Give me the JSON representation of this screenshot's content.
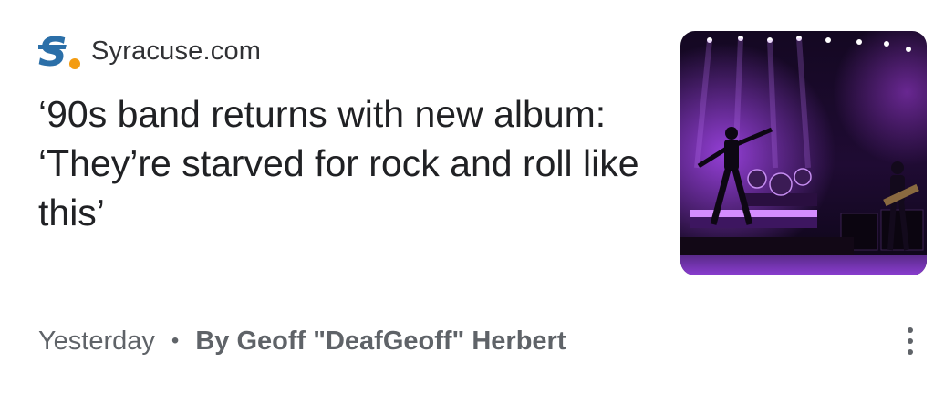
{
  "publisher": {
    "logo_icon": "syracuse-s-logo",
    "name": "Syracuse.com",
    "logo_colors": {
      "letter": "#2b6fa8",
      "dot": "#f39c12"
    }
  },
  "headline": "‘90s band returns with new album: ‘They’re starved for rock and roll like this’",
  "thumbnail": {
    "icon": "concert-stage-photo",
    "dominant_colors": [
      "#1a0a2e",
      "#7a2fb8",
      "#c45cf0"
    ]
  },
  "meta": {
    "time": "Yesterday",
    "separator": "•",
    "author": "By Geoff \"DeafGeoff\" Herbert"
  },
  "more_menu": {
    "icon": "more-vert-icon"
  }
}
